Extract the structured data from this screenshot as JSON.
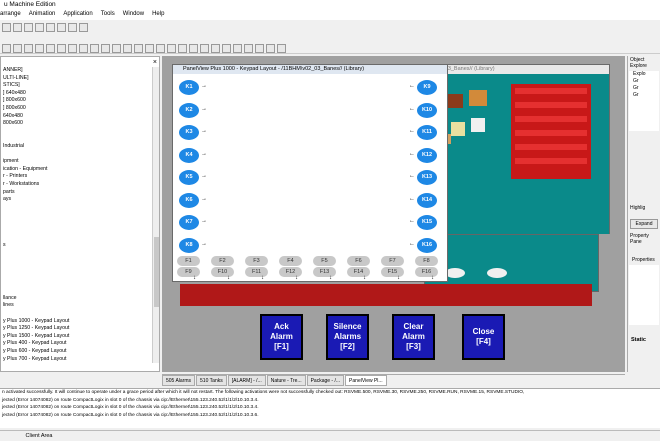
{
  "app": {
    "title": "u Machine Edition"
  },
  "menu": [
    "arrange",
    "Animation",
    "Application",
    "Tools",
    "Window",
    "Help"
  ],
  "left_tree": [
    "ANNER]",
    "ULTI-LINE]",
    "STICS]",
    "] 640x480",
    "] 800x600",
    "] 800x600",
    "640x480",
    "800x600",
    "",
    "",
    "Industrial",
    "",
    "ipment",
    "ication - Equipment",
    "r - Printers",
    "r - Workstations",
    "parts",
    "ays",
    "",
    "",
    "",
    "",
    "",
    "s",
    "",
    "",
    "",
    "",
    "",
    "",
    "llance",
    "lines",
    "",
    "y Plus 1000 - Keypad Layout",
    "y Plus 1250 - Keypad Layout",
    "y Plus 1500 - Keypad Layout",
    "y Plus 400 - Keypad Layout",
    "y Plus 600 - Keypad Layout",
    "y Plus 700 - Keypad Layout"
  ],
  "windows": {
    "keypad_title": "PanelView Plus 1000 - Keypad Layout - /11BHM\\v02_03_Banes// (Library)",
    "library_title": "...40_03_Banes// (Library)"
  },
  "keypad": {
    "left_keys": [
      "K1",
      "K2",
      "K3",
      "K4",
      "K5",
      "K6",
      "K7",
      "K8"
    ],
    "right_keys": [
      "K9",
      "K10",
      "K11",
      "K12",
      "K13",
      "K14",
      "K15",
      "K16"
    ],
    "f_top": [
      "F1",
      "F2",
      "F3",
      "F4",
      "F5",
      "F6",
      "F7",
      "F8"
    ],
    "f_bottom": [
      "F9",
      "F10",
      "F11",
      "F12",
      "F13",
      "F14",
      "F15",
      "F16"
    ]
  },
  "alarm_buttons": [
    {
      "line1": "Ack",
      "line2": "Alarm",
      "line3": "[F1]"
    },
    {
      "line1": "Silence",
      "line2": "Alarms",
      "line3": "[F2]"
    },
    {
      "line1": "Clear",
      "line2": "Alarm",
      "line3": "[F3]"
    },
    {
      "line1": "Close",
      "line2": "",
      "line3": "[F4]"
    }
  ],
  "tabs": [
    "505 Alarms",
    "510 Tanks",
    "[ALARM] - /...",
    "Nature - Tre...",
    "Package - /...",
    "PanelView Pl..."
  ],
  "right_panel": {
    "title": "Object Explore",
    "items": [
      "Explo",
      "Gr",
      "Gr",
      "Gr"
    ],
    "highlight": "Highlig",
    "expand": "Expand",
    "property": "Property Pane",
    "properties": "Properties",
    "static": "Static"
  },
  "output_lines": [
    "n activated successfully. It will continue to operate under a grace period after which it will not restart. The following activations were not successfully checked out: RSVME.500, RSVME.30, RSVME.250, RSVME.RUN, RSVME.15, RSVME.STUDIO,",
    "jected (Error 14074082) on route CompactLogix in slot 0 of the chassis via cip://Ethernet\\155.123.240.52\\1\\1\\2\\10.10.3.4.",
    "jected (Error 14074082) on route CompactLogix in slot 0 of the chassis via cip://Ethernet\\155.123.240.52\\1\\1\\2\\10.10.3.4.",
    "jected (Error 14074082) on route CompactLogix in slot 0 of the chassis via cip://Ethernet\\155.123.240.52\\1\\1\\2\\10.10.3.6."
  ],
  "status": {
    "text": "Client Area"
  },
  "colors": {
    "teal": "#0a8a8a",
    "keypad_blue": "#1e88e5",
    "alarm_button": "#1a1ab4",
    "red_bar": "#b01818"
  }
}
